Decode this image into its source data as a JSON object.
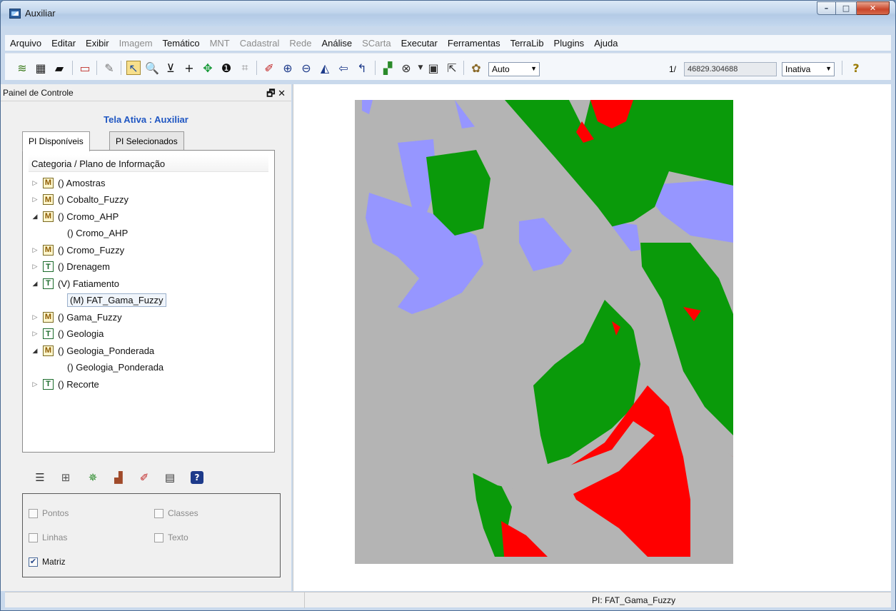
{
  "window": {
    "title": "Auxiliar"
  },
  "menu": [
    {
      "label": "Arquivo",
      "enabled": true
    },
    {
      "label": "Editar",
      "enabled": true
    },
    {
      "label": "Exibir",
      "enabled": true
    },
    {
      "label": "Imagem",
      "enabled": false
    },
    {
      "label": "Temático",
      "enabled": true
    },
    {
      "label": "MNT",
      "enabled": false
    },
    {
      "label": "Cadastral",
      "enabled": false
    },
    {
      "label": "Rede",
      "enabled": false
    },
    {
      "label": "Análise",
      "enabled": true
    },
    {
      "label": "SCarta",
      "enabled": false
    },
    {
      "label": "Executar",
      "enabled": true
    },
    {
      "label": "Ferramentas",
      "enabled": true
    },
    {
      "label": "TerraLib",
      "enabled": true
    },
    {
      "label": "Plugins",
      "enabled": true
    },
    {
      "label": "Ajuda",
      "enabled": true
    }
  ],
  "toolbar": {
    "scale_mode": "Auto",
    "scale_prefix": "1/",
    "scale_value": "46829.304688",
    "state": "Inativa"
  },
  "panel": {
    "title": "Painel de Controle",
    "float_close": "🗗 ✕",
    "active_screen": "Tela Ativa : Auxiliar",
    "tabs": [
      "PI Disponíveis",
      "PI Selecionados"
    ],
    "tree_header": "Categoria / Plano de Informação",
    "tree": [
      {
        "label": "() Amostras",
        "badge": "M",
        "expander": "▷",
        "level": 0
      },
      {
        "label": "() Cobalto_Fuzzy",
        "badge": "M",
        "expander": "▷",
        "level": 0
      },
      {
        "label": "() Cromo_AHP",
        "badge": "M",
        "expander": "◢",
        "level": 0
      },
      {
        "label": "() Cromo_AHP",
        "badge": "",
        "expander": "",
        "level": 1
      },
      {
        "label": "() Cromo_Fuzzy",
        "badge": "M",
        "expander": "▷",
        "level": 0
      },
      {
        "label": "() Drenagem",
        "badge": "T",
        "expander": "▷",
        "level": 0
      },
      {
        "label": "(V) Fatiamento",
        "badge": "T",
        "expander": "◢",
        "level": 0
      },
      {
        "label": "(M) FAT_Gama_Fuzzy",
        "badge": "",
        "expander": "",
        "level": 1,
        "selected": true
      },
      {
        "label": "() Gama_Fuzzy",
        "badge": "M",
        "expander": "▷",
        "level": 0
      },
      {
        "label": "() Geologia",
        "badge": "T",
        "expander": "▷",
        "level": 0
      },
      {
        "label": "() Geologia_Ponderada",
        "badge": "M",
        "expander": "◢",
        "level": 0
      },
      {
        "label": "() Geologia_Ponderada",
        "badge": "",
        "expander": "",
        "level": 1
      },
      {
        "label": "() Recorte",
        "badge": "T",
        "expander": "▷",
        "level": 0
      }
    ],
    "checks": {
      "pontos": {
        "label": "Pontos",
        "checked": false
      },
      "classes": {
        "label": "Classes",
        "checked": false
      },
      "linhas": {
        "label": "Linhas",
        "checked": false
      },
      "texto": {
        "label": "Texto",
        "checked": false
      },
      "matriz": {
        "label": "Matriz",
        "checked": true
      }
    }
  },
  "map": {
    "colors": {
      "background": "#b4b4b4",
      "green": "#0a9a0a",
      "red": "#ff0000",
      "blue": "#9696ff",
      "gray": "#b4b4b4"
    }
  },
  "status": {
    "pi": "PI: FAT_Gama_Fuzzy"
  }
}
